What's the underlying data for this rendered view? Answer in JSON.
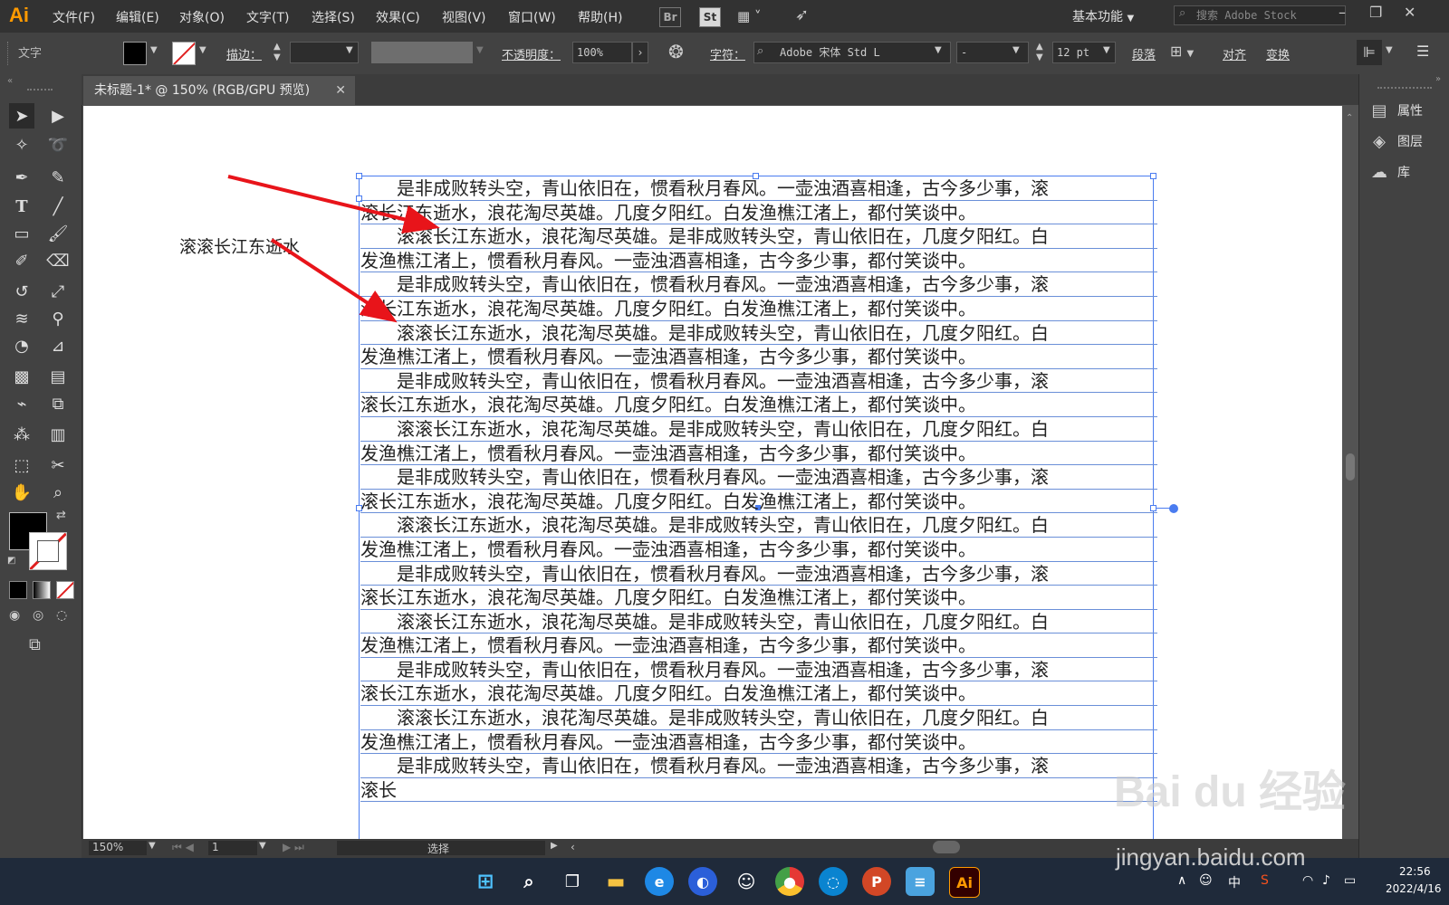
{
  "app": {
    "logo": "Ai",
    "menus": [
      "文件(F)",
      "编辑(E)",
      "对象(O)",
      "文字(T)",
      "选择(S)",
      "效果(C)",
      "视图(V)",
      "窗口(W)",
      "帮助(H)"
    ],
    "bridge_icon": "Br",
    "stock_icon": "St",
    "workspace": "基本功能",
    "search_placeholder": "搜索 Adobe Stock",
    "accent": "#ff9a00"
  },
  "control": {
    "mode_label": "文字",
    "stroke_label": "描边：",
    "opacity_label": "不透明度：",
    "opacity_value": "100%",
    "char_label": "字符：",
    "font_name": "Adobe 宋体 Std L",
    "font_style": "-",
    "font_size": "12 pt",
    "paragraph_label": "段落",
    "align_label": "对齐",
    "transform_label": "变换"
  },
  "document": {
    "tab_title": "未标题-1* @ 150% (RGB/GPU 预览)",
    "free_text": "滚滚长江东逝水",
    "lines": [
      "　　是非成败转头空，青山依旧在，惯看秋月春风。一壶浊酒喜相逢，古今多少事，滚",
      "滚长江东逝水，浪花淘尽英雄。几度夕阳红。白发渔樵江渚上，都付笑谈中。",
      "　　滚滚长江东逝水，浪花淘尽英雄。是非成败转头空，青山依旧在，几度夕阳红。白",
      "发渔樵江渚上，惯看秋月春风。一壶浊酒喜相逢，古今多少事，都付笑谈中。",
      "　　是非成败转头空，青山依旧在，惯看秋月春风。一壶浊酒喜相逢，古今多少事，滚",
      "滚长江东逝水，浪花淘尽英雄。几度夕阳红。白发渔樵江渚上，都付笑谈中。",
      "　　滚滚长江东逝水，浪花淘尽英雄。是非成败转头空，青山依旧在，几度夕阳红。白",
      "发渔樵江渚上，惯看秋月春风。一壶浊酒喜相逢，古今多少事，都付笑谈中。",
      "　　是非成败转头空，青山依旧在，惯看秋月春风。一壶浊酒喜相逢，古今多少事，滚",
      "滚长江东逝水，浪花淘尽英雄。几度夕阳红。白发渔樵江渚上，都付笑谈中。",
      "　　滚滚长江东逝水，浪花淘尽英雄。是非成败转头空，青山依旧在，几度夕阳红。白",
      "发渔樵江渚上，惯看秋月春风。一壶浊酒喜相逢，古今多少事，都付笑谈中。",
      "　　是非成败转头空，青山依旧在，惯看秋月春风。一壶浊酒喜相逢，古今多少事，滚",
      "滚长江东逝水，浪花淘尽英雄。几度夕阳红。白发渔樵江渚上，都付笑谈中。",
      "　　滚滚长江东逝水，浪花淘尽英雄。是非成败转头空，青山依旧在，几度夕阳红。白",
      "发渔樵江渚上，惯看秋月春风。一壶浊酒喜相逢，古今多少事，都付笑谈中。",
      "　　是非成败转头空，青山依旧在，惯看秋月春风。一壶浊酒喜相逢，古今多少事，滚",
      "滚长江东逝水，浪花淘尽英雄。几度夕阳红。白发渔樵江渚上，都付笑谈中。",
      "　　滚滚长江东逝水，浪花淘尽英雄。是非成败转头空，青山依旧在，几度夕阳红。白",
      "发渔樵江渚上，惯看秋月春风。一壶浊酒喜相逢，古今多少事，都付笑谈中。",
      "　　是非成败转头空，青山依旧在，惯看秋月春风。一壶浊酒喜相逢，古今多少事，滚",
      "滚长江东逝水，浪花淘尽英雄。几度夕阳红。白发渔樵江渚上，都付笑谈中。",
      "　　滚滚长江东逝水，浪花淘尽英雄。是非成败转头空，青山依旧在，几度夕阳红。白",
      "发渔樵江渚上，惯看秋月春风。一壶浊酒喜相逢，古今多少事，都付笑谈中。",
      "　　是非成败转头空，青山依旧在，惯看秋月春风。一壶浊酒喜相逢，古今多少事，滚",
      "滚长"
    ]
  },
  "panels": {
    "properties": "属性",
    "layers": "图层",
    "libraries": "库"
  },
  "status": {
    "zoom": "150%",
    "artboard": "1",
    "tool": "选择"
  },
  "taskbar": {
    "ime": "中",
    "time": "22:56",
    "date": "2022/4/16"
  },
  "watermark": {
    "brand": "Bai du 经验",
    "url": "jingyan.baidu.com"
  }
}
